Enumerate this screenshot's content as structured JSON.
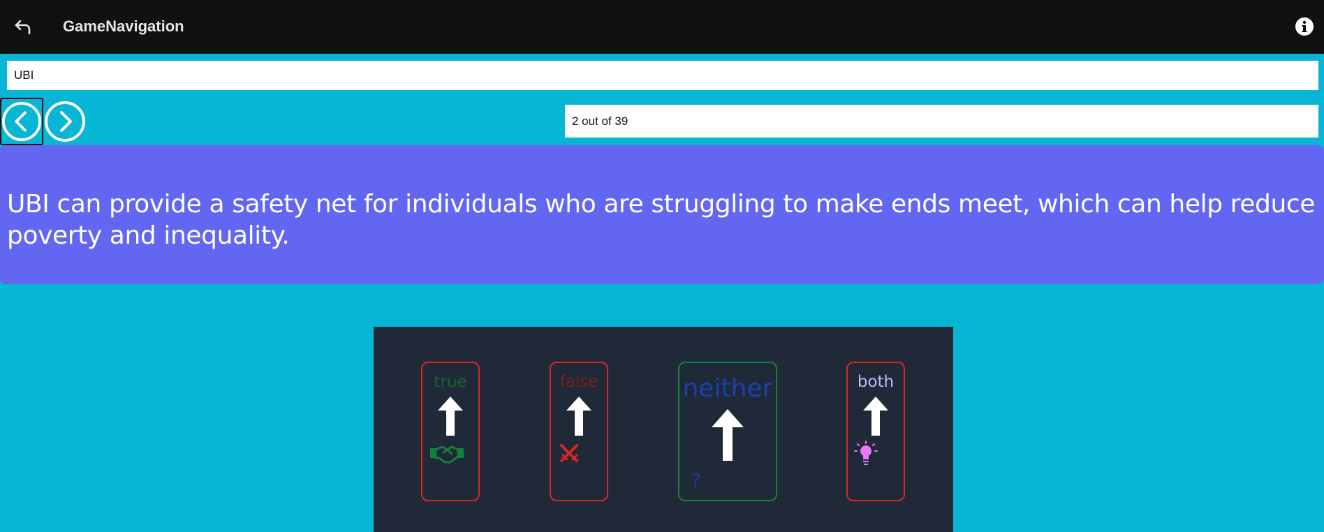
{
  "header": {
    "title": "GameNavigation",
    "back_icon": "undo-arrow-icon",
    "info_icon": "info-circle-icon"
  },
  "search": {
    "value": "UBI",
    "placeholder": ""
  },
  "navigation": {
    "prev_icon": "chevron-left-circle-icon",
    "next_icon": "chevron-right-circle-icon",
    "counter_text": "2 out of 39",
    "current": 2,
    "total": 39
  },
  "statement": {
    "text": "UBI can provide a safety net for individuals who are struggling to make ends meet, which can help reduce poverty and inequality."
  },
  "choices": [
    {
      "label": "true",
      "icon": "handshake-icon",
      "label_color": "#166534",
      "border_color": "#dc2626"
    },
    {
      "label": "false",
      "icon": "crossed-swords-icon",
      "label_color": "#7f1d1d",
      "border_color": "#dc2626"
    },
    {
      "label": "neither",
      "icon": "question-mark-icon",
      "label_color": "#1e40af",
      "border_color": "#15803d"
    },
    {
      "label": "both",
      "icon": "lightbulb-icon",
      "label_color": "#c4b5fd",
      "border_color": "#dc2626"
    }
  ],
  "colors": {
    "topbar": "#111111",
    "background": "#06b6d4",
    "statement_card": "#6366f1",
    "game_panel": "#1f2937"
  }
}
